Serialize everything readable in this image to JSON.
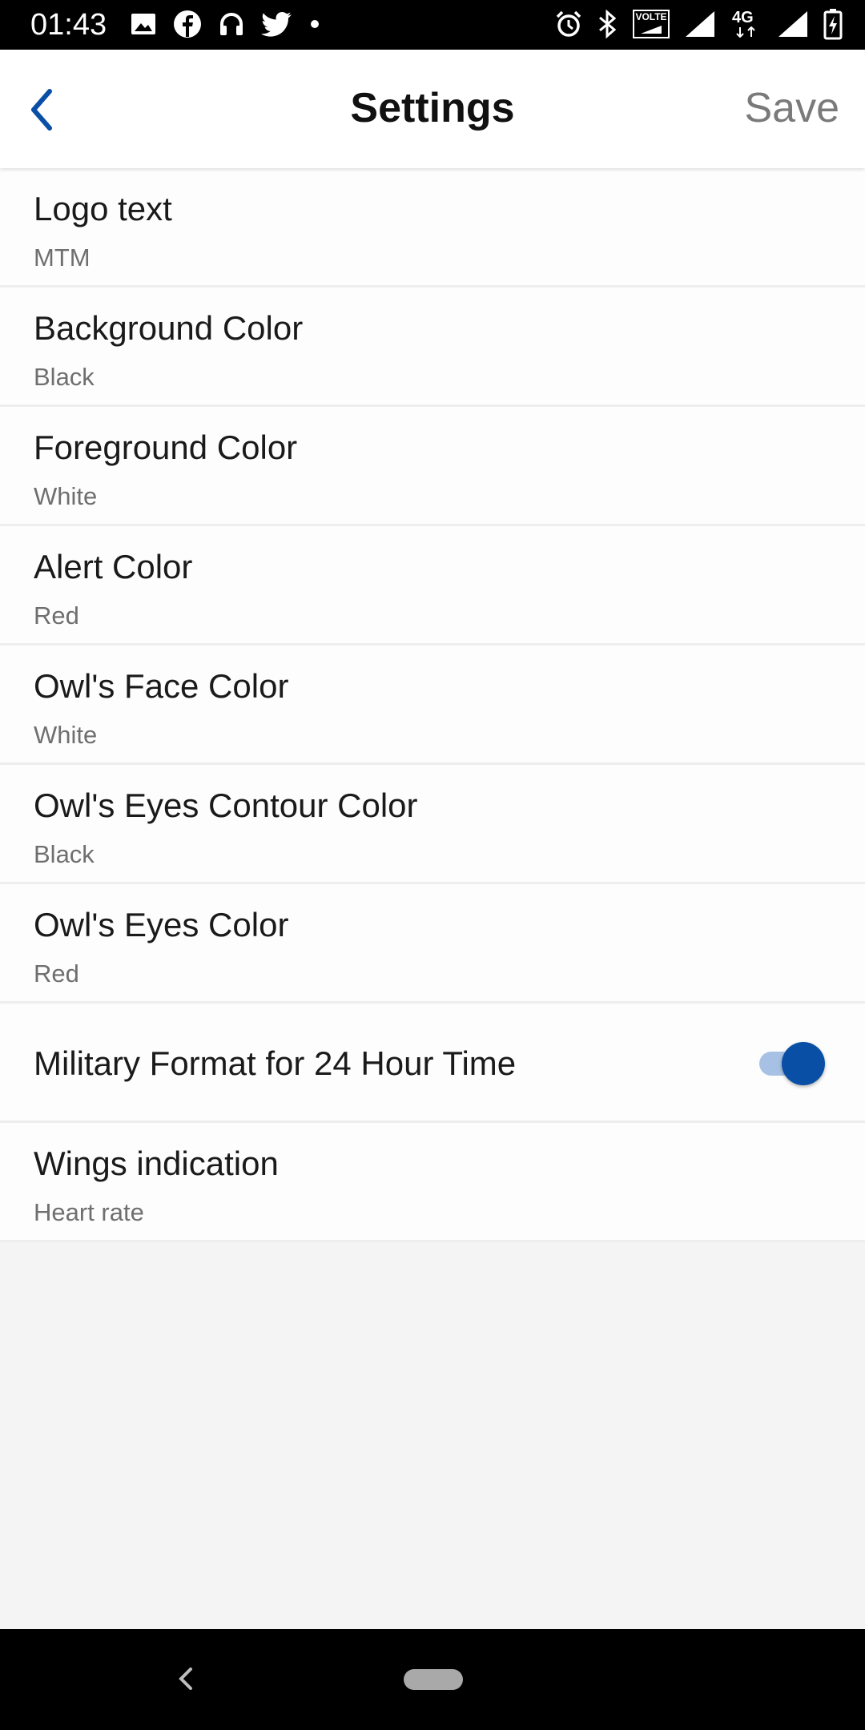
{
  "status_bar": {
    "time": "01:43",
    "left_icons": [
      "image-icon",
      "facebook-icon",
      "headphones-icon",
      "twitter-icon",
      "dot-icon"
    ],
    "right_icons": [
      "alarm-icon",
      "bluetooth-icon",
      "volte-icon",
      "signal-icon",
      "4g-icon",
      "signal-icon",
      "battery-charging-icon"
    ],
    "volte_label": "VOLTE",
    "network_label": "4G"
  },
  "app_bar": {
    "title": "Settings",
    "save_label": "Save",
    "back_icon": "chevron-left-icon",
    "accent_color": "#0a4fa6"
  },
  "settings": [
    {
      "label": "Logo text",
      "value": "MTM"
    },
    {
      "label": "Background Color",
      "value": "Black"
    },
    {
      "label": "Foreground Color",
      "value": "White"
    },
    {
      "label": "Alert Color",
      "value": "Red"
    },
    {
      "label": "Owl's Face Color",
      "value": "White"
    },
    {
      "label": "Owl's Eyes Contour Color",
      "value": "Black"
    },
    {
      "label": "Owl's Eyes Color",
      "value": "Red"
    },
    {
      "label": "Military Format for 24 Hour Time",
      "toggle": true
    },
    {
      "label": "Wings indication",
      "value": "Heart rate"
    }
  ],
  "nav_bar": {
    "back_icon": "nav-back-icon",
    "home_icon": "nav-home-pill"
  }
}
